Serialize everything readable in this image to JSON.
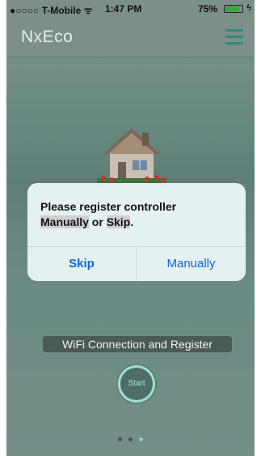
{
  "status_bar": {
    "carrier": "●○○○○ T-Mobile ᯤ",
    "time": "1:47 PM",
    "battery": "75%",
    "battery_level": 0.75
  },
  "nav": {
    "title": "NxEco",
    "menu_icon": "hamburger-menu-icon"
  },
  "dialog": {
    "line1": "Please register controller",
    "manually_word": "Manually",
    "or_word": " or ",
    "skip_word": "Skip",
    "period": ".",
    "skip_button": "Skip",
    "manually_button": "Manually"
  },
  "main": {
    "wifi_label": "WiFi Connection and Register",
    "start_button": "Start"
  },
  "pager": {
    "count": 3,
    "active_index": 2
  },
  "colors": {
    "accent": "#2f8a7c",
    "dialog_button": "#1463d8",
    "start_ring": "#9fdfd3"
  }
}
